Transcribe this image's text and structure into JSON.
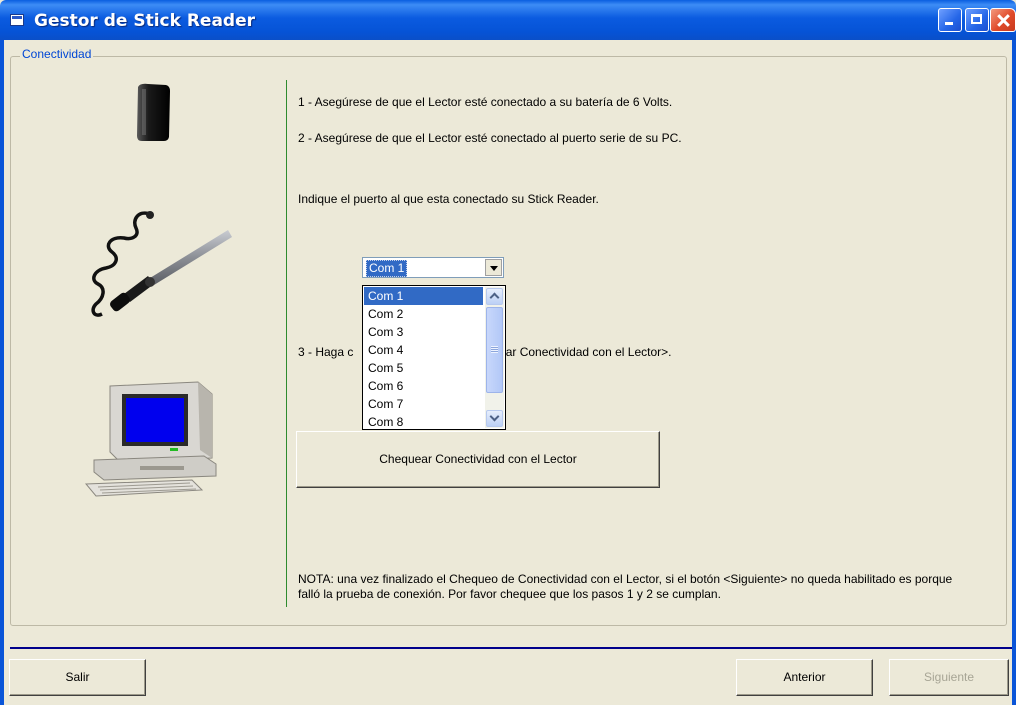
{
  "window": {
    "title": "Gestor de Stick Reader"
  },
  "group": {
    "label": "Conectividad"
  },
  "instructions": {
    "step1": "1 - Asegúrese de que el Lector esté conectado a su batería de 6 Volts.",
    "step2": "2 - Asegúrese de que el Lector esté conectado al puerto serie de su PC.",
    "prompt": "Indique el puerto al que esta conectado su Stick Reader.",
    "step3_left": "3 - Haga c",
    "step3_right": "uear Conectividad con el Lector>."
  },
  "port_combo": {
    "selected": "Com 1",
    "options": [
      "Com 1",
      "Com 2",
      "Com 3",
      "Com 4",
      "Com 5",
      "Com 6",
      "Com 7",
      "Com 8"
    ]
  },
  "check_button": {
    "label": "Chequear Conectividad con el Lector"
  },
  "note": "NOTA: una vez finalizado el Chequeo de Conectividad con el Lector, si el botón <Siguiente> no queda habilitado es porque falló la prueba de conexión. Por favor chequee que los pasos 1 y 2 se cumplan.",
  "footer": {
    "exit_label": "Salir",
    "back_label": "Anterior",
    "next_label": "Siguiente"
  },
  "icons": {
    "app": "app-window-icon",
    "battery": "battery-icon",
    "reader": "stick-reader-icon",
    "computer": "computer-icon"
  },
  "colors": {
    "titlebar": "#0b5be0",
    "selection": "#316ac5",
    "group_label": "#0046d5",
    "divider": "#2e8b2e",
    "bottom_separator": "#00008b",
    "window_background": "#ece9d8"
  }
}
